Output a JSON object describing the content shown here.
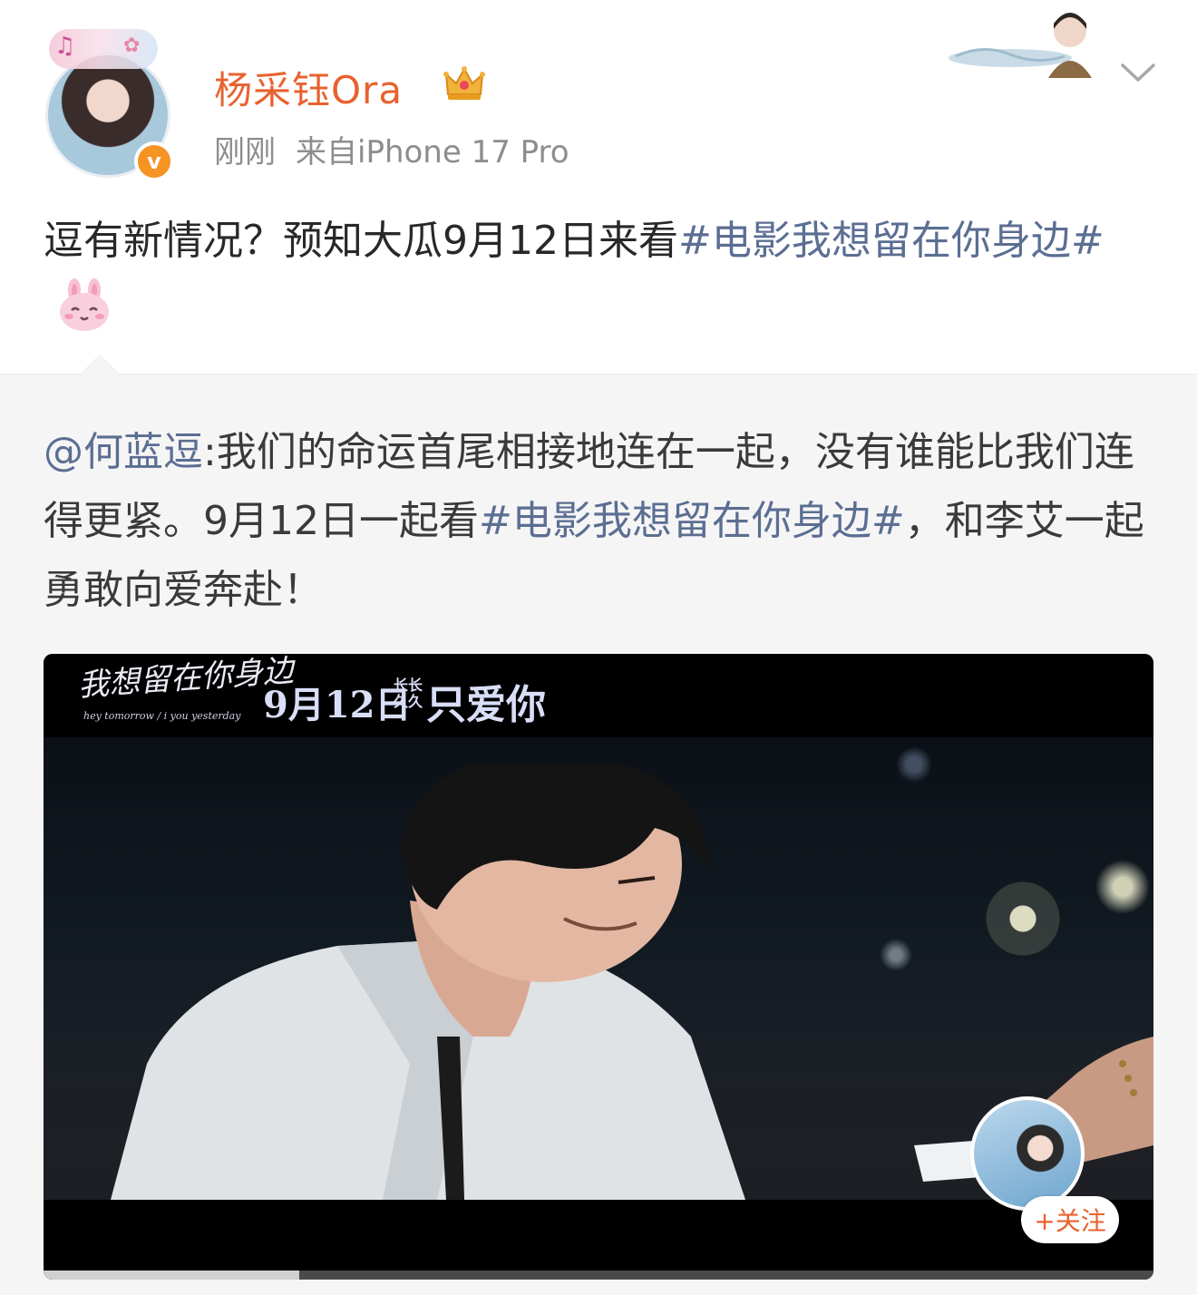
{
  "post": {
    "username": "杨采钰Ora",
    "time": "刚刚",
    "source": "来自iPhone 17 Pro",
    "text_plain": "逗有新情况？预知大瓜9月12日来看",
    "topic": "#电影我想留在你身边#",
    "emoji": "rabbit-emoji"
  },
  "repost": {
    "mention": "@何蓝逗",
    "text_before": ":我们的命运首尾相接地连在一起，没有谁能比我们连得更紧。9月12日一起看",
    "topic": "#电影我想留在你身边#",
    "text_after": "，和李艾一起勇敢向爱奔赴！"
  },
  "video": {
    "banner_title": "我想留在你身边",
    "banner_subtitle": "hey tomorrow / i you yesterday",
    "banner_date": "9月12日",
    "banner_small": "长长久久",
    "banner_slogan": "只爱你",
    "follow_label": "+关注",
    "progress": 0.23
  },
  "colors": {
    "username": "#e8622f",
    "topic": "#5b6e93",
    "meta": "#8d8d8d",
    "verified": "#f59323"
  }
}
